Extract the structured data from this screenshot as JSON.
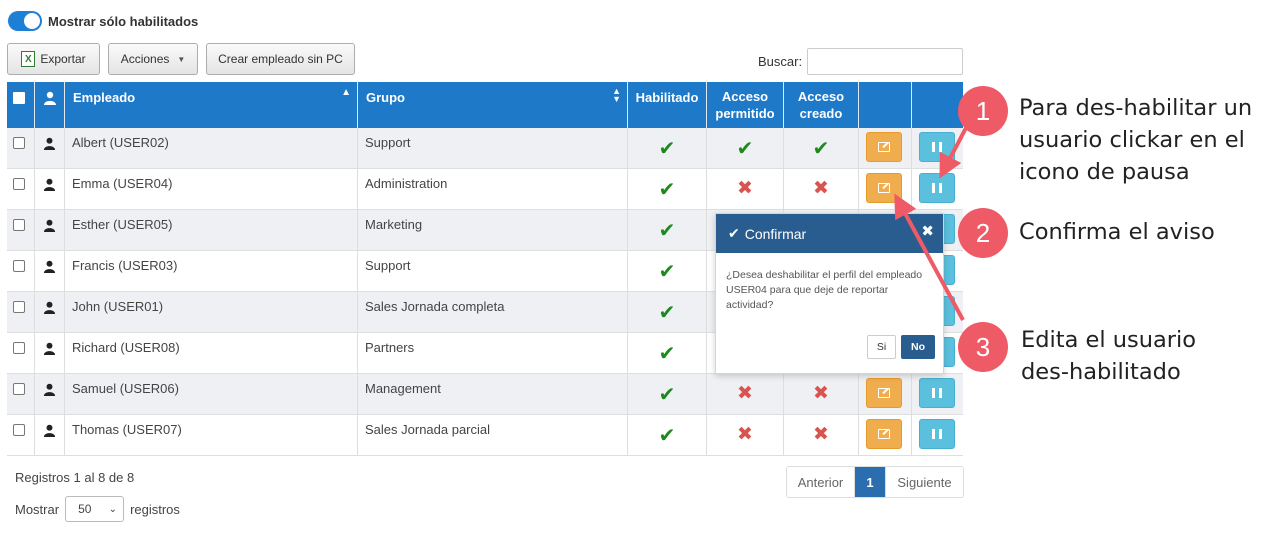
{
  "filter": {
    "toggle_label": "Mostrar sólo habilitados",
    "toggle_on": true
  },
  "toolbar": {
    "export_label": "Exportar",
    "actions_label": "Acciones",
    "create_label": "Crear empleado sin PC",
    "search_label": "Buscar:",
    "search_value": ""
  },
  "table": {
    "headers": {
      "employee": "Empleado",
      "group": "Grupo",
      "enabled": "Habilitado",
      "access_allowed_1": "Acceso",
      "access_allowed_2": "permitido",
      "access_created_1": "Acceso",
      "access_created_2": "creado"
    },
    "rows": [
      {
        "employee": "Albert (USER02)",
        "group": "Support",
        "enabled": true,
        "access_allowed": true,
        "access_created": true
      },
      {
        "employee": "Emma (USER04)",
        "group": "Administration",
        "enabled": true,
        "access_allowed": false,
        "access_created": false
      },
      {
        "employee": "Esther (USER05)",
        "group": "Marketing",
        "enabled": true,
        "access_allowed": null,
        "access_created": null
      },
      {
        "employee": "Francis (USER03)",
        "group": "Support",
        "enabled": true,
        "access_allowed": null,
        "access_created": null
      },
      {
        "employee": "John (USER01)",
        "group": "Sales Jornada completa",
        "enabled": true,
        "access_allowed": null,
        "access_created": null
      },
      {
        "employee": "Richard (USER08)",
        "group": "Partners",
        "enabled": true,
        "access_allowed": null,
        "access_created": null
      },
      {
        "employee": "Samuel (USER06)",
        "group": "Management",
        "enabled": true,
        "access_allowed": false,
        "access_created": false
      },
      {
        "employee": "Thomas (USER07)",
        "group": "Sales Jornada parcial",
        "enabled": true,
        "access_allowed": false,
        "access_created": false
      }
    ]
  },
  "footer": {
    "records_info": "Registros 1 al 8 de 8",
    "show_label": "Mostrar",
    "page_size": "50",
    "records_label": "registros",
    "prev_label": "Anterior",
    "current_page": "1",
    "next_label": "Siguiente"
  },
  "confirm": {
    "title": "Confirmar",
    "message": "¿Desea deshabilitar el perfil del empleado USER04 para que deje de reportar actividad?",
    "yes_label": "Si",
    "no_label": "No"
  },
  "annotations": {
    "steps": [
      {
        "number": "1",
        "lines": [
          "Para des-habilitar un",
          "usuario clickar en el",
          "icono de pausa"
        ]
      },
      {
        "number": "2",
        "lines": [
          "Confirma el aviso"
        ]
      },
      {
        "number": "3",
        "lines": [
          "Edita el usuario",
          "des-habilitado"
        ]
      }
    ],
    "accent_color": "#ee5a66"
  },
  "colors": {
    "header_bg": "#1e79c8",
    "tick": "#1e8a1e",
    "cross": "#d9534f",
    "edit_button": "#f0ad4e",
    "pause_button": "#5bc0de",
    "popover_header": "#2a5d8f"
  }
}
